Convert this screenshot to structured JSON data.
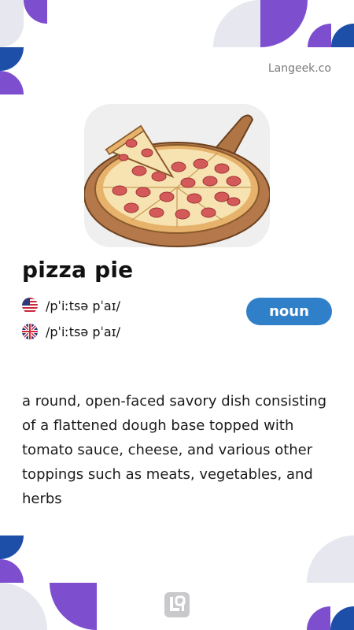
{
  "brand": "Langeek.co",
  "word": "pizza pie",
  "pronunciations": [
    {
      "region": "us",
      "flag_icon": "us-flag-icon",
      "ipa": "/pˈiːtsə pˈaɪ/"
    },
    {
      "region": "uk",
      "flag_icon": "uk-flag-icon",
      "ipa": "/pˈiːtsə pˈaɪ/"
    }
  ],
  "part_of_speech": "noun",
  "definition": "a round, open-faced savory dish consisting of a flattened dough base topped with tomato sauce, cheese, and various other toppings such as meats, vegetables, and herbs",
  "colors": {
    "badge": "#2f80c8",
    "accent_purple": "#7d4fcf",
    "accent_blue": "#1d4fa8",
    "accent_grey": "#e6e7ef"
  }
}
